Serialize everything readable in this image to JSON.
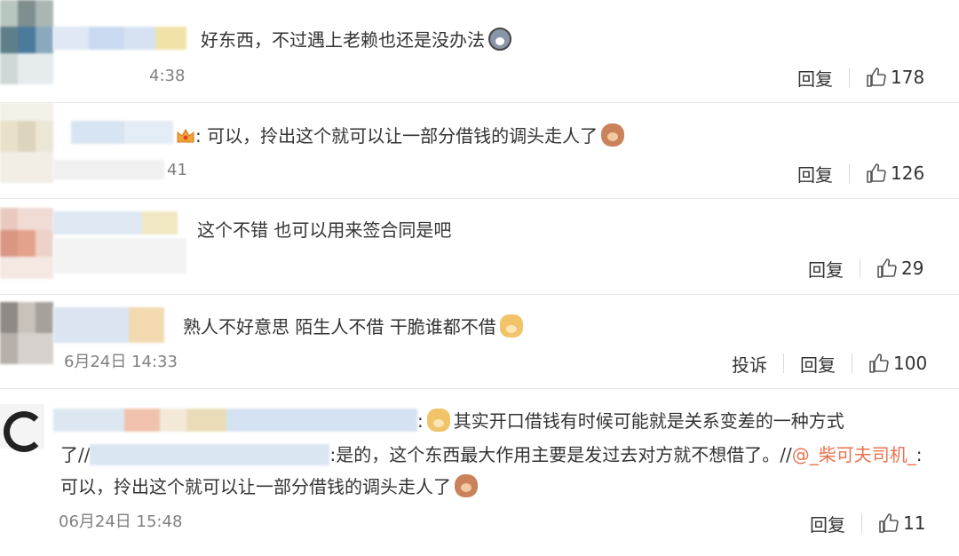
{
  "comments": [
    {
      "text": "好东西，不过遇上老赖也还是没办法",
      "emoji": "husky-emoji",
      "time": "4:38",
      "actions": {
        "reply": "回复",
        "likes": "178"
      }
    },
    {
      "text": ": 可以，拎出这个就可以让一部分借钱的调头走人了",
      "emoji": "mouse-emoji",
      "time": "41",
      "actions": {
        "reply": "回复",
        "likes": "126"
      }
    },
    {
      "text": "这个不错 也可以用来签合同是吧",
      "actions": {
        "reply": "回复",
        "likes": "29"
      }
    },
    {
      "text": "熟人不好意思 陌生人不借 干脆谁都不借",
      "emoji": "doge-emoji",
      "time": "6月24日 14:33",
      "actions": {
        "report": "投诉",
        "reply": "回复",
        "likes": "100"
      }
    },
    {
      "line1": "其实开口借钱有时候可能就是关系变差的一种方式",
      "line2_prefix": "了//",
      "line2_mid": ":是的，这个东西最大作用主要是发过去对方就不想借了。//",
      "mention": "@_柴可夫司机_",
      "line2_suffix": ":",
      "line3": "可以，拎出这个就可以让一部分借钱的调头走人了",
      "time": "06月24日 15:48",
      "actions": {
        "reply": "回复",
        "likes": "11"
      }
    }
  ],
  "colors": {
    "divider": "#e6e6e6",
    "text": "#333333",
    "time": "#808080",
    "mention": "#eb7350"
  }
}
